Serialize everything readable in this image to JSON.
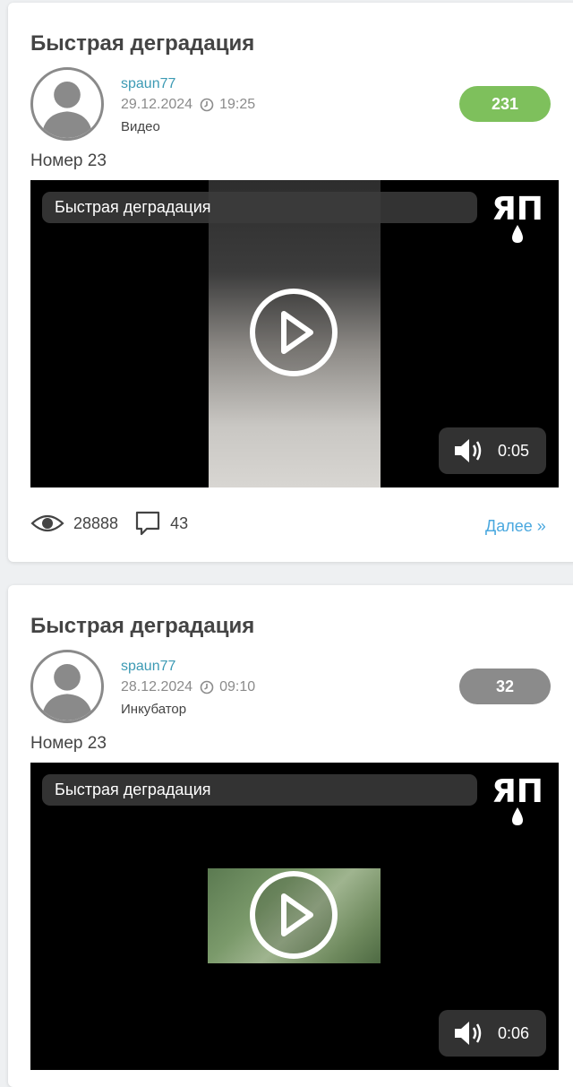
{
  "posts": [
    {
      "title": "Быстрая деградация",
      "author": "spaun77",
      "date": "29.12.2024",
      "time": "19:25",
      "category": "Видео",
      "rating": "231",
      "rating_color": "#7ec05c",
      "subtitle": "Номер 23",
      "video": {
        "title": "Быстрая деградация",
        "duration": "0:05",
        "logo": "ЯП"
      },
      "views": "28888",
      "comments": "43",
      "more_label": "Далее »"
    },
    {
      "title": "Быстрая деградация",
      "author": "spaun77",
      "date": "28.12.2024",
      "time": "09:10",
      "category": "Инкубатор",
      "rating": "32",
      "rating_color": "#8b8b8b",
      "subtitle": "Номер 23",
      "video": {
        "title": "Быстрая деградация",
        "duration": "0:06",
        "logo": "ЯП"
      }
    }
  ],
  "icons": [
    "avatar-icon",
    "clock-icon",
    "play-icon",
    "volume-icon",
    "eye-icon",
    "comment-icon",
    "yap-logo"
  ]
}
